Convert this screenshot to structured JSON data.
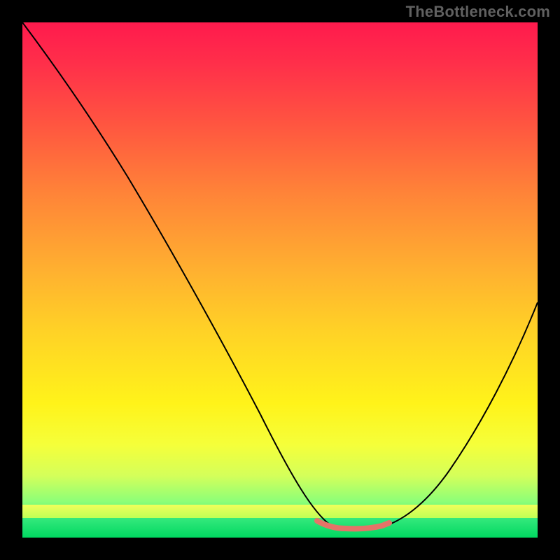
{
  "watermark": "TheBottleneck.com",
  "chart_data": {
    "type": "line",
    "title": "",
    "xlabel": "",
    "ylabel": "",
    "xlim": [
      0,
      100
    ],
    "ylim": [
      0,
      100
    ],
    "series": [
      {
        "name": "curve",
        "x": [
          0,
          5,
          10,
          15,
          20,
          25,
          30,
          35,
          40,
          45,
          50,
          55,
          58,
          60,
          63,
          66,
          70,
          75,
          80,
          85,
          90,
          95,
          100
        ],
        "values": [
          100,
          93,
          86,
          79,
          72,
          64,
          56,
          48,
          39,
          30,
          20,
          10,
          4,
          2,
          1,
          1,
          3,
          8,
          16,
          26,
          38,
          48,
          54
        ]
      },
      {
        "name": "accent-region",
        "x": [
          57,
          60,
          63,
          66,
          69,
          71
        ],
        "values": [
          3.2,
          2.0,
          1.5,
          1.6,
          2.2,
          3.1
        ]
      }
    ],
    "background_gradient": {
      "colors_top_to_bottom": [
        "#ff1a4d",
        "#ff8338",
        "#ffd226",
        "#fff31a",
        "#8cff78",
        "#00d860"
      ]
    }
  }
}
